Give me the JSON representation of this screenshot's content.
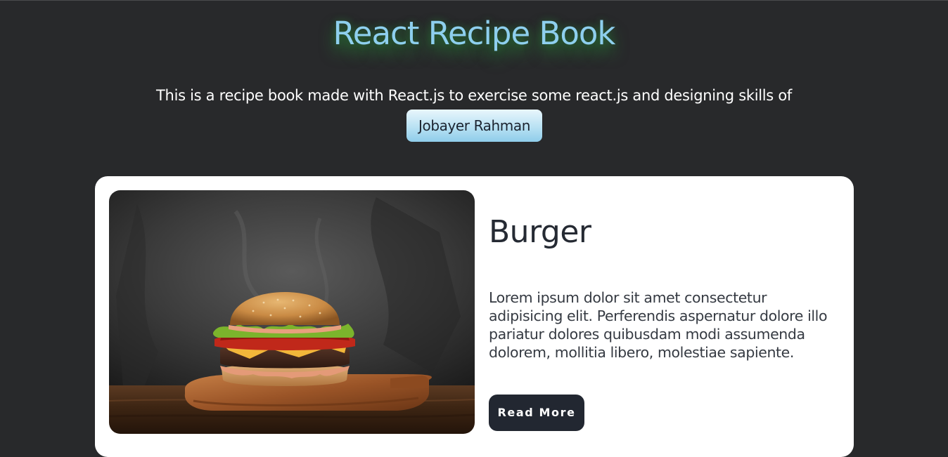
{
  "header": {
    "title": "React Recipe Book",
    "subtitle": "This is a recipe book made with React.js to exercise some react.js and designing skills of",
    "author_button_label": "Jobayer Rahman"
  },
  "recipes": [
    {
      "name": "Burger",
      "image": "burger-photo",
      "description": "Lorem ipsum dolor sit amet consectetur adipisicing elit. Perferendis aspernatur dolore illo pariatur dolores quibusdam modi assumenda dolorem, mollitia libero, molestiae sapiente.",
      "button_label": "Read More"
    }
  ],
  "colors": {
    "page_background": "#28292b",
    "title": "#8ecfee",
    "title_glow": "#28aa3c",
    "card_background": "#ffffff",
    "button_dark": "#222731",
    "author_button": "#b8e1f3"
  }
}
